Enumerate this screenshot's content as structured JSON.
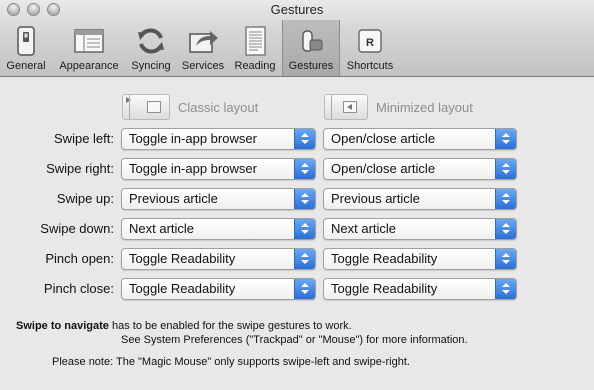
{
  "window": {
    "title": "Gestures"
  },
  "toolbar": {
    "items": [
      {
        "label": "General",
        "icon": "switch-icon"
      },
      {
        "label": "Appearance",
        "icon": "window-layout-icon"
      },
      {
        "label": "Syncing",
        "icon": "sync-icon"
      },
      {
        "label": "Services",
        "icon": "share-arrow-icon"
      },
      {
        "label": "Reading",
        "icon": "document-icon"
      },
      {
        "label": "Gestures",
        "icon": "gesture-icon",
        "active": true
      },
      {
        "label": "Shortcuts",
        "icon": "keyboard-key-icon",
        "key_glyph": "R"
      }
    ]
  },
  "layouts": {
    "classic": "Classic layout",
    "minimized": "Minimized layout"
  },
  "gestures": [
    {
      "label": "Swipe left:",
      "classic": "Toggle in-app browser",
      "minimized": "Open/close article"
    },
    {
      "label": "Swipe right:",
      "classic": "Toggle in-app browser",
      "minimized": "Open/close article"
    },
    {
      "label": "Swipe up:",
      "classic": "Previous article",
      "minimized": "Previous article"
    },
    {
      "label": "Swipe down:",
      "classic": "Next article",
      "minimized": "Next article"
    },
    {
      "label": "Pinch open:",
      "classic": "Toggle Readability",
      "minimized": "Toggle Readability"
    },
    {
      "label": "Pinch close:",
      "classic": "Toggle Readability",
      "minimized": "Toggle Readability"
    }
  ],
  "notes": {
    "swipe_bold": "Swipe to navigate",
    "swipe_rest": " has to be enabled for the swipe gestures to work.",
    "swipe_line2": "See System Preferences (\"Trackpad\" or \"Mouse\") for more information.",
    "magic_mouse": "Please note: The \"Magic Mouse\" only supports swipe-left and swipe-right."
  },
  "colors": {
    "accent": "#2c6fd6",
    "window_bg": "#e8e8e8"
  }
}
